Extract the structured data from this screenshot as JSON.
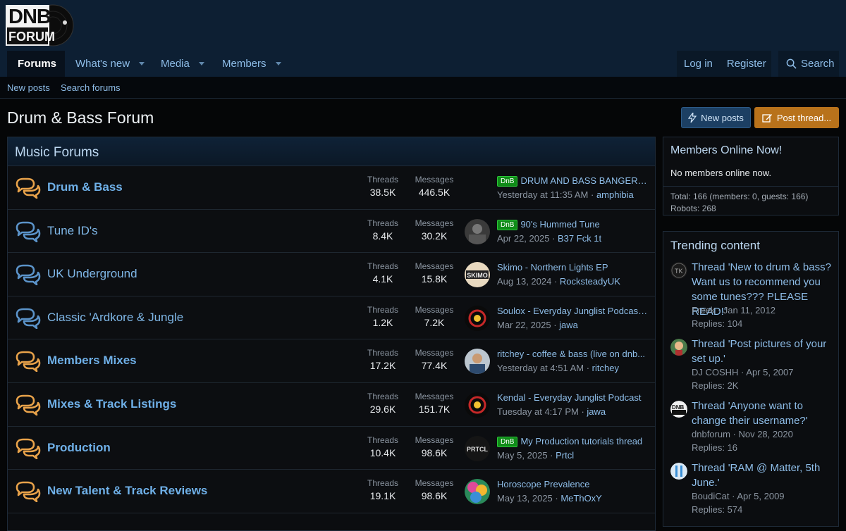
{
  "logo": {
    "line1": "DNB",
    "line2": "FORUM"
  },
  "nav": {
    "forums": "Forums",
    "whats_new": "What's new",
    "media": "Media",
    "members": "Members",
    "login": "Log in",
    "register": "Register",
    "search": "Search"
  },
  "subnav": {
    "new_posts": "New posts",
    "search_forums": "Search forums"
  },
  "page_title": "Drum & Bass Forum",
  "buttons": {
    "new_posts": "New posts",
    "post_thread": "Post thread..."
  },
  "section": {
    "title": "Music Forums",
    "threads_label": "Threads",
    "messages_label": "Messages"
  },
  "forums": [
    {
      "name": "Drum & Bass",
      "unread": true,
      "threads": "38.5K",
      "messages": "446.5K",
      "prefix": "DnB",
      "last_title": "DRUM AND BASS BANGERS /...",
      "last_date": "Yesterday at 11:35 AM",
      "last_user": "amphibia",
      "avatar": "none"
    },
    {
      "name": "Tune ID's",
      "unread": false,
      "threads": "8.4K",
      "messages": "30.2K",
      "prefix": "DnB",
      "last_title": "90's Hummed Tune",
      "last_date": "Apr 22, 2025",
      "last_user": "B37 Fck 1t",
      "avatar": "photo-gray"
    },
    {
      "name": "UK Underground",
      "unread": false,
      "threads": "4.1K",
      "messages": "15.8K",
      "prefix": "",
      "last_title": "Skimo - Northern Lights EP",
      "last_date": "Aug 13, 2024",
      "last_user": "RocksteadyUK",
      "avatar": "skimo"
    },
    {
      "name": "Classic 'Ardkore & Jungle",
      "unread": false,
      "threads": "1.2K",
      "messages": "7.2K",
      "prefix": "",
      "last_title": "Soulox - Everyday Junglist Podcast ...",
      "last_date": "Mar 22, 2025",
      "last_user": "jawa",
      "avatar": "junglist"
    },
    {
      "name": "Members Mixes",
      "unread": true,
      "threads": "17.2K",
      "messages": "77.4K",
      "prefix": "",
      "last_title": "ritchey - coffee & bass (live on dnb...",
      "last_date": "Yesterday at 4:51 AM",
      "last_user": "ritchey",
      "avatar": "person"
    },
    {
      "name": "Mixes & Track Listings",
      "unread": true,
      "threads": "29.6K",
      "messages": "151.7K",
      "prefix": "",
      "last_title": "Kendal - Everyday Junglist Podcast",
      "last_date": "Tuesday at 4:17 PM",
      "last_user": "jawa",
      "avatar": "junglist"
    },
    {
      "name": "Production",
      "unread": true,
      "threads": "10.4K",
      "messages": "98.6K",
      "prefix": "DnB",
      "last_title": "My Production tutorials thread",
      "last_date": "May 5, 2025",
      "last_user": "Prtcl",
      "avatar": "prtcl"
    },
    {
      "name": "New Talent & Track Reviews",
      "unread": true,
      "threads": "19.1K",
      "messages": "98.6K",
      "prefix": "",
      "last_title": "Horoscope Prevalence",
      "last_date": "May 13, 2025",
      "last_user": "MeThOxY",
      "avatar": "colorful"
    }
  ],
  "avatars": {
    "skimo": "SKIMO",
    "prtcl": "PRTCL"
  },
  "online": {
    "title": "Members Online Now!",
    "text": "No members online now.",
    "total": "Total: 166 (members: 0, guests: 166)",
    "robots": "Robots: 268"
  },
  "trending": {
    "title": "Trending content",
    "items": [
      {
        "title": "Thread 'New to drum & bass? Want us to recommend you some tunes??? PLEASE READ!'",
        "meta": "Freek · Jan 11, 2012",
        "replies": "Replies: 104",
        "avatar": "tk"
      },
      {
        "title": "Thread 'Post pictures of your set up.'",
        "meta": "DJ COSHH · Apr 5, 2007",
        "replies": "Replies: 2K",
        "avatar": "cartoon"
      },
      {
        "title": "Thread 'Anyone want to change their username?'",
        "meta": "dnbforum · Nov 28, 2020",
        "replies": "Replies: 16",
        "avatar": "dnb"
      },
      {
        "title": "Thread 'RAM @ Matter, 5th June.'",
        "meta": "BoudiCat · Apr 5, 2009",
        "replies": "Replies: 574",
        "avatar": "ram"
      }
    ]
  },
  "colors": {
    "accent": "#8ebde8",
    "unread_icon": "#e8a24a",
    "read_icon": "#5b93c9",
    "prefix_green": "#0f8c18",
    "post_button": "#b8721b"
  }
}
